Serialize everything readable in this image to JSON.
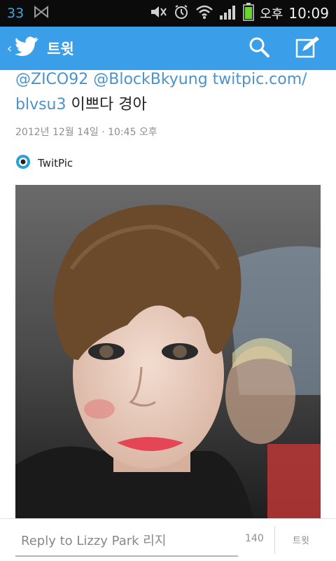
{
  "status_bar": {
    "notification_count": "33",
    "ampm": "오후",
    "time": "10:09"
  },
  "action_bar": {
    "back_label": "‹",
    "title": "트윗"
  },
  "tweet": {
    "mention1": "@ZICO92",
    "mention2": "@BlockBkyung",
    "link": "twitpic.com/blvsu3",
    "link_line1": "twitpic.com/",
    "link_line2": "blvsu3",
    "message": "이쁘다 경아",
    "timestamp": "2012년 12월 14일 · 10:45 오후",
    "source_name": "TwitPic"
  },
  "reply": {
    "placeholder": "Reply to Lizzy Park 리지",
    "char_count": "140",
    "send_label": "트윗"
  },
  "colors": {
    "accent": "#3b9ee8",
    "link": "#4c93c9",
    "status_bar": "#0b0b0b"
  }
}
